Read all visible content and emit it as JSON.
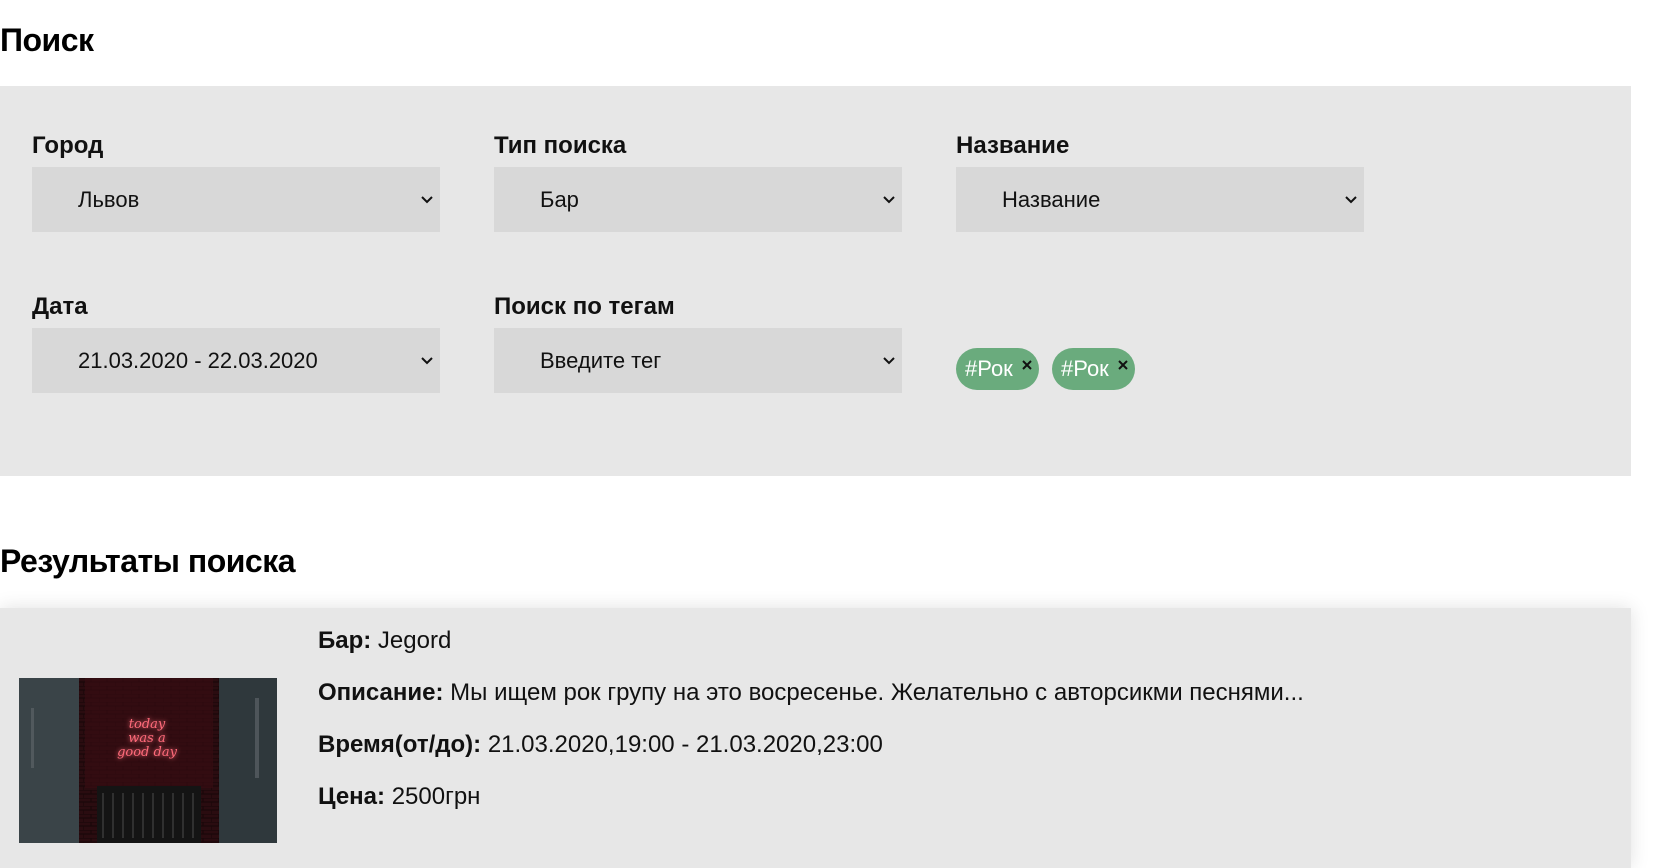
{
  "search": {
    "title": "Поиск",
    "city": {
      "label": "Город",
      "value": "Львов"
    },
    "search_type": {
      "label": "Тип поиска",
      "value": "Бар"
    },
    "name": {
      "label": "Название",
      "value": "Название"
    },
    "date": {
      "label": "Дата",
      "value": "21.03.2020 - 22.03.2020"
    },
    "tags_search": {
      "label": "Поиск по тегам",
      "value": "Введите тег"
    },
    "selected_tags": [
      "#Рок",
      "#Рок"
    ],
    "icons": {
      "dropdown": "chevron-down-icon",
      "remove_tag": "close-icon"
    },
    "colors": {
      "panel": "#e7e7e7",
      "select": "#d8d8d8",
      "tag": "#6aab7d"
    }
  },
  "results": {
    "title": "Результаты поиска",
    "items": [
      {
        "image_text": "today was a good day",
        "bar_label": "Бар:",
        "bar_value": "Jegord",
        "description_label": "Описание:",
        "description_value": "Мы ищем рок групу на это восресенье. Желательно с авторсикми песнями...",
        "time_label": "Время(от/до):",
        "time_value": "21.03.2020,19:00 - 21.03.2020,23:00",
        "price_label": "Цена:",
        "price_value": "2500грн"
      }
    ]
  }
}
